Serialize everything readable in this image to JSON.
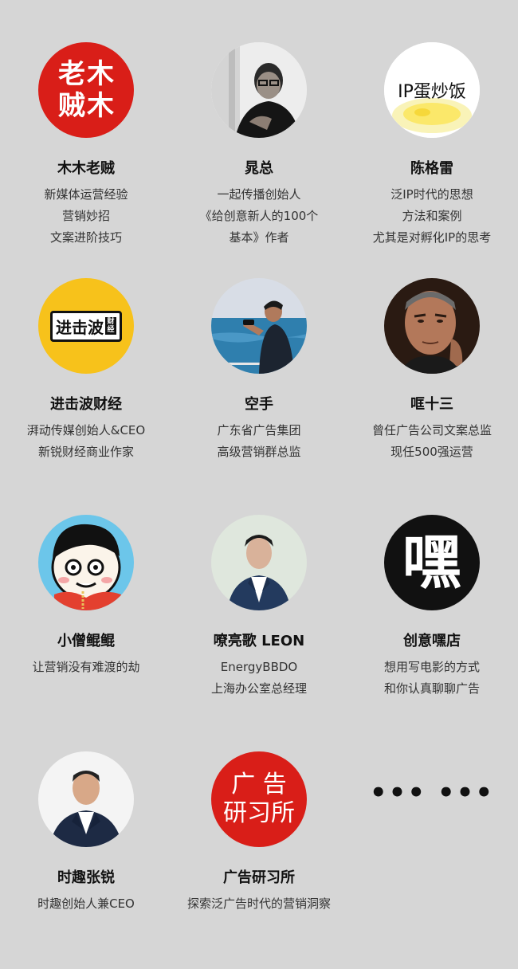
{
  "colors": {
    "background": "#d6d6d6",
    "red": "#d91e18",
    "yellow": "#f7c21b",
    "black": "#111111"
  },
  "profiles": [
    {
      "name": "木木老贼",
      "lines": [
        "新媒体运营经验",
        "营销妙招",
        "文案进阶技巧"
      ],
      "avatar_text": [
        "老",
        "木",
        "贼",
        "木"
      ]
    },
    {
      "name": "晁总",
      "lines": [
        "一起传播创始人",
        "《给创意新人的100个",
        "基本》作者"
      ],
      "avatar": "photo-man-glasses"
    },
    {
      "name": "陈格雷",
      "lines": [
        "泛IP时代的思想",
        "方法和案例",
        "尤其是对孵化IP的思考"
      ],
      "avatar_text": "IP蛋炒饭"
    },
    {
      "name": "进击波财经",
      "lines": [
        "湃动传媒创始人&CEO",
        "新锐财经商业作家"
      ],
      "avatar_text": "进击波",
      "avatar_small": "财经"
    },
    {
      "name": "空手",
      "lines": [
        "广东省广告集团",
        "高级营销群总监"
      ],
      "avatar": "photo-man-sea"
    },
    {
      "name": "哐十三",
      "lines": [
        "曾任广告公司文案总监",
        "现任500强运营"
      ],
      "avatar": "photo-man-portrait"
    },
    {
      "name": "小僧鲲鲲",
      "lines": [
        "让营销没有难渡的劫"
      ],
      "avatar": "cartoon-monk"
    },
    {
      "name": "嘹亮歌 LEON",
      "lines": [
        "EnergyBBDO",
        "上海办公室总经理"
      ],
      "avatar": "photo-man-suit"
    },
    {
      "name": "创意嘿店",
      "lines": [
        "想用写电影的方式",
        "和你认真聊聊广告"
      ],
      "avatar_text": "嘿"
    },
    {
      "name": "时趣张锐",
      "lines": [
        "时趣创始人兼CEO"
      ],
      "avatar": "photo-man-white-bg"
    },
    {
      "name": "广告研习所",
      "lines": [
        "探索泛广告时代的营销洞察"
      ],
      "avatar_text": [
        "广",
        "告",
        "研",
        "习",
        "所"
      ]
    },
    {
      "more": "••• •••"
    }
  ]
}
